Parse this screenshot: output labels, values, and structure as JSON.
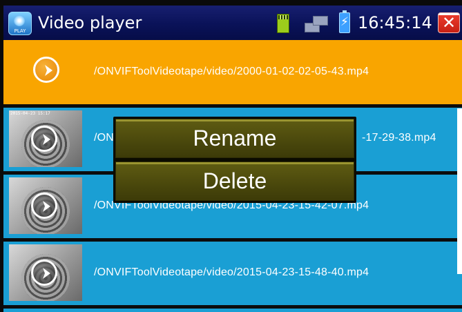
{
  "window": {
    "title": "Video player",
    "app_icon": "video-player-app-icon",
    "app_icon_text": "PLAY",
    "clock": "16:45:14",
    "status_icons": [
      "sd-card-icon",
      "network-icon",
      "battery-charging-icon"
    ],
    "close_icon": "close-icon"
  },
  "files": [
    {
      "path": "/ONVIFToolVideotape/video/2000-01-02-02-05-43.mp4",
      "selected": true,
      "has_thumbnail": false
    },
    {
      "path": "/ONVIFToolVideotape/video/2015-04-23-15-17-29-38.mp4",
      "visible_start": "/ON",
      "visible_end": "-17-29-38.mp4",
      "selected": false,
      "has_thumbnail": true,
      "thumb_stamp": "2015-04-23 15:17"
    },
    {
      "path": "/ONVIFToolVideotape/video/2015-04-23-15-42-07.mp4",
      "selected": false,
      "has_thumbnail": true
    },
    {
      "path": "/ONVIFToolVideotape/video/2015-04-23-15-48-40.mp4",
      "selected": false,
      "has_thumbnail": true
    }
  ],
  "context_menu": {
    "rename_label": "Rename",
    "delete_label": "Delete"
  },
  "colors": {
    "selected_row": "#f9a500",
    "normal_row": "#1a9fd4",
    "titlebar": "#0a1258",
    "menu_button": "#4a470c"
  }
}
